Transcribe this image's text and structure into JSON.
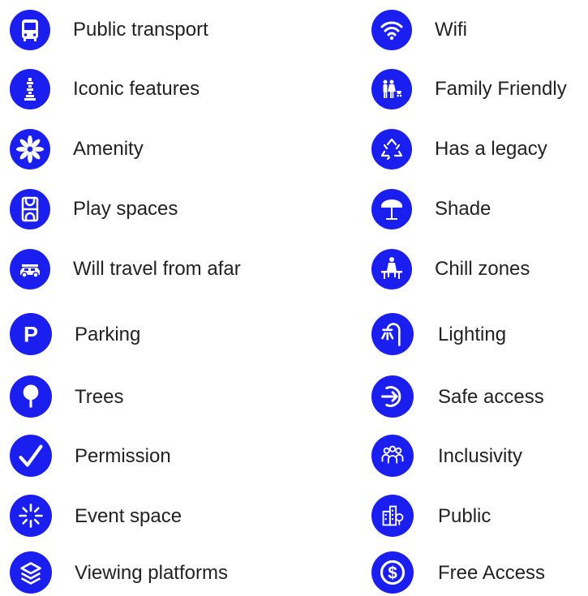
{
  "colors": {
    "icon_bg": "#1a1ff0",
    "icon_fg": "#ffffff",
    "text": "#222222"
  },
  "left_column": [
    {
      "label": "Public transport",
      "icon": "bus-icon"
    },
    {
      "label": "Iconic features",
      "icon": "iconic-feature-icon"
    },
    {
      "label": "Amenity",
      "icon": "flower-icon"
    },
    {
      "label": "Play spaces",
      "icon": "court-icon"
    },
    {
      "label": "Will travel from afar",
      "icon": "car-icon"
    },
    {
      "label": "Parking",
      "icon": "parking-icon"
    },
    {
      "label": "Trees",
      "icon": "tree-icon"
    },
    {
      "label": "Permission",
      "icon": "checkmark-icon"
    },
    {
      "label": "Event space",
      "icon": "burst-icon"
    },
    {
      "label": "Viewing platforms",
      "icon": "layers-icon"
    }
  ],
  "right_column": [
    {
      "label": "Wifi",
      "icon": "wifi-icon"
    },
    {
      "label": "Family Friendly",
      "icon": "family-icon"
    },
    {
      "label": "Has a legacy",
      "icon": "recycle-icon"
    },
    {
      "label": "Shade",
      "icon": "umbrella-icon"
    },
    {
      "label": "Chill zones",
      "icon": "bench-person-icon"
    },
    {
      "label": "Lighting",
      "icon": "street-light-icon"
    },
    {
      "label": "Safe access",
      "icon": "enter-icon"
    },
    {
      "label": "Inclusivity",
      "icon": "group-icon"
    },
    {
      "label": "Public",
      "icon": "city-icon"
    },
    {
      "label": "Free Access",
      "icon": "dollar-icon"
    }
  ]
}
